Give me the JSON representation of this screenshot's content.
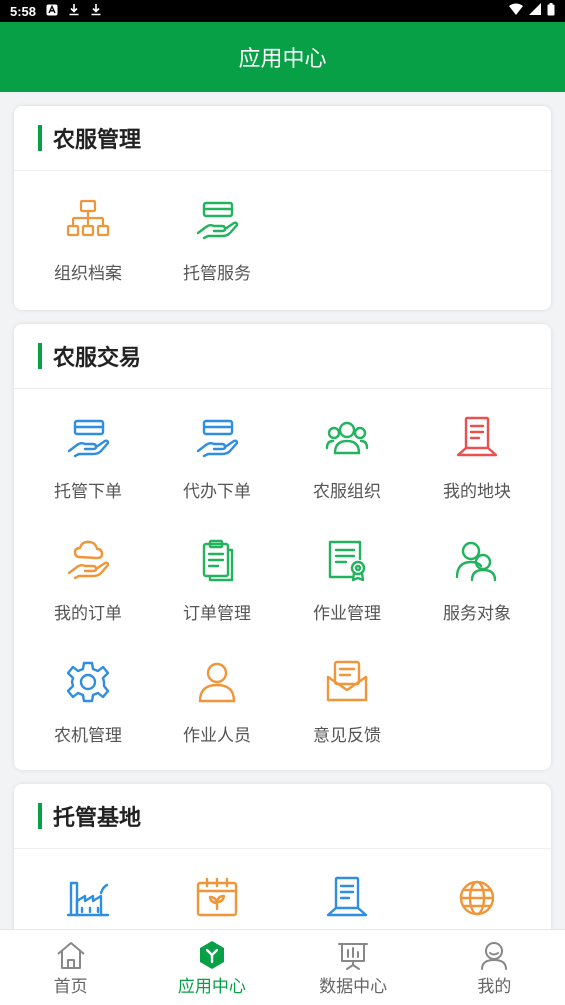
{
  "status_bar": {
    "time": "5:58"
  },
  "app_bar": {
    "title": "应用中心"
  },
  "sections": [
    {
      "title": "农服管理",
      "items": [
        {
          "label": "组织档案",
          "icon": "org-chart-icon",
          "color": "#f0963a"
        },
        {
          "label": "托管服务",
          "icon": "hand-card-icon",
          "color": "#22b35e"
        }
      ]
    },
    {
      "title": "农服交易",
      "items": [
        {
          "label": "托管下单",
          "icon": "hand-card-icon",
          "color": "#2f8ee0"
        },
        {
          "label": "代办下单",
          "icon": "hand-card-icon",
          "color": "#2f8ee0"
        },
        {
          "label": "农服组织",
          "icon": "group-icon",
          "color": "#22b35e"
        },
        {
          "label": "我的地块",
          "icon": "land-icon",
          "color": "#ea5050"
        },
        {
          "label": "我的订单",
          "icon": "hand-cloud-icon",
          "color": "#f0963a"
        },
        {
          "label": "订单管理",
          "icon": "clipboard-icon",
          "color": "#22b35e"
        },
        {
          "label": "作业管理",
          "icon": "certificate-icon",
          "color": "#22b35e"
        },
        {
          "label": "服务对象",
          "icon": "users-icon",
          "color": "#22b35e"
        },
        {
          "label": "农机管理",
          "icon": "gear-icon",
          "color": "#2f8ee0"
        },
        {
          "label": "作业人员",
          "icon": "person-icon",
          "color": "#f0963a"
        },
        {
          "label": "意见反馈",
          "icon": "mail-icon",
          "color": "#f0963a"
        }
      ]
    },
    {
      "title": "托管基地",
      "items": [
        {
          "label": "",
          "icon": "factory-icon",
          "color": "#2f8ee0"
        },
        {
          "label": "",
          "icon": "calendar-plant-icon",
          "color": "#f0963a"
        },
        {
          "label": "",
          "icon": "document-icon",
          "color": "#2f8ee0"
        },
        {
          "label": "",
          "icon": "globe-icon",
          "color": "#f0963a"
        }
      ]
    }
  ],
  "tabs": [
    {
      "label": "首页",
      "icon": "home-icon",
      "active": false
    },
    {
      "label": "应用中心",
      "icon": "app-center-icon",
      "active": true
    },
    {
      "label": "数据中心",
      "icon": "data-board-icon",
      "active": false
    },
    {
      "label": "我的",
      "icon": "profile-icon",
      "active": false
    }
  ],
  "colors": {
    "primary": "#07a046"
  }
}
